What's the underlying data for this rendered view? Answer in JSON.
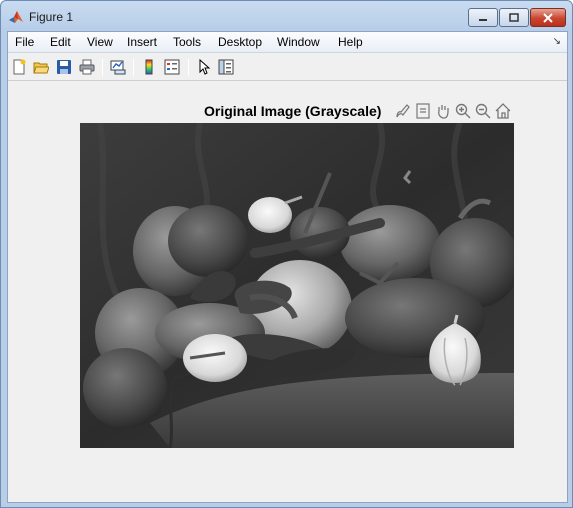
{
  "window": {
    "title": "Figure 1",
    "buttons": {
      "minimize": "minimize-icon",
      "maximize": "maximize-icon",
      "close": "close-icon"
    }
  },
  "menu": {
    "items": [
      "File",
      "Edit",
      "View",
      "Insert",
      "Tools",
      "Desktop",
      "Window",
      "Help"
    ]
  },
  "toolbar": {
    "icons": [
      "new-figure-icon",
      "open-file-icon",
      "save-icon",
      "print-icon",
      "link-plot-icon",
      "insert-colorbar-icon",
      "insert-legend-icon",
      "edit-plot-icon",
      "property-inspector-icon"
    ]
  },
  "axes": {
    "title": "Original Image (Grayscale)",
    "tools": [
      "brush-icon",
      "data-tips-icon",
      "pan-icon",
      "zoom-in-icon",
      "zoom-out-icon",
      "restore-view-icon"
    ]
  },
  "image": {
    "subject": "peppers",
    "colormap": "grayscale"
  }
}
